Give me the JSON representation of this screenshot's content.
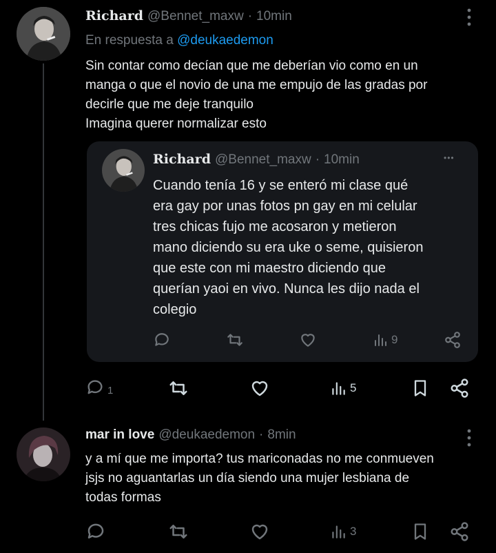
{
  "tweet1": {
    "display_name": "Richard",
    "handle": "@Bennet_maxw",
    "separator": "·",
    "time": "10min",
    "reply_prefix": "En respuesta a",
    "reply_to": "@deukaedemon",
    "text": "Sin contar como decían que me deberían vio como en un\nmanga o que el novio de una me empujo de las gradas por\ndecirle que me deje tranquilo\nImagina querer normalizar esto",
    "actions": {
      "replies": "1",
      "retweets": "",
      "likes": "",
      "views": "5"
    }
  },
  "quote": {
    "display_name": "Richard",
    "handle": "@Bennet_maxw",
    "separator": "·",
    "time": "10min",
    "more": "•••",
    "text": "Cuando tenía 16 y se enteró mi clase qué\nera gay por unas fotos pn gay en mi celular\ntres chicas fujo me acosaron y metieron\nmano diciendo su era uke o seme, quisieron\nque este con mi maestro diciendo que\nquerían yaoi en vivo. Nunca les dijo nada el\ncolegio",
    "actions": {
      "views": "9"
    }
  },
  "tweet2": {
    "display_name": "mar in love",
    "handle": "@deukaedemon",
    "separator": "·",
    "time": "8min",
    "text": "y a mí que me importa? tus mariconadas no me conmueven\njsjs no aguantarlas un día siendo una mujer lesbiana de\ntodas formas",
    "actions": {
      "views": "3"
    }
  },
  "colors": {
    "background": "#000000",
    "text": "#e7e9ea",
    "muted": "#71767b",
    "link": "#1d9bf0",
    "card": "#16181c"
  },
  "icons": [
    "more-vertical-icon",
    "more-horizontal-icon",
    "reply-icon",
    "retweet-icon",
    "like-icon",
    "views-icon",
    "bookmark-icon",
    "share-icon"
  ]
}
